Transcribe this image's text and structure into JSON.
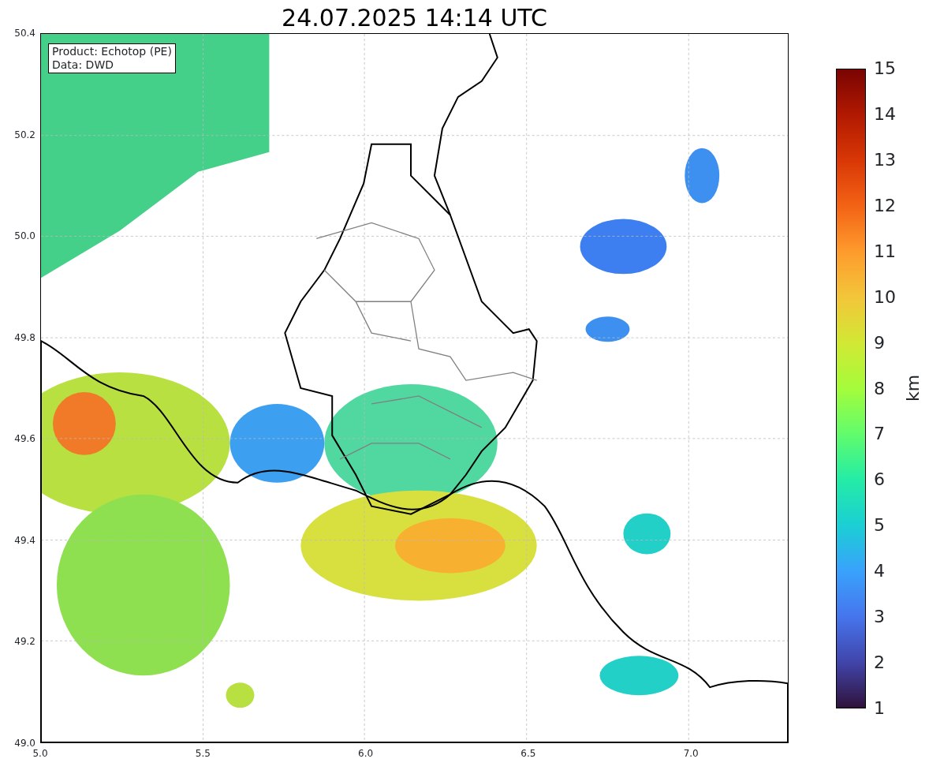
{
  "title": "24.07.2025 14:14 UTC",
  "info_box": [
    "Product: Echotop (PE)",
    "Data: DWD"
  ],
  "x_ticks": [
    "5.0",
    "5.5",
    "6.0",
    "6.5",
    "7.0"
  ],
  "y_ticks": [
    "50.4",
    "50.2",
    "50.0",
    "49.8",
    "49.6",
    "49.4",
    "49.2",
    "49.0"
  ],
  "colorbar": {
    "label": "km",
    "ticks": [
      "15",
      "14",
      "13",
      "12",
      "11",
      "10",
      "9",
      "8",
      "7",
      "6",
      "5",
      "4",
      "3",
      "2",
      "1"
    ]
  }
}
